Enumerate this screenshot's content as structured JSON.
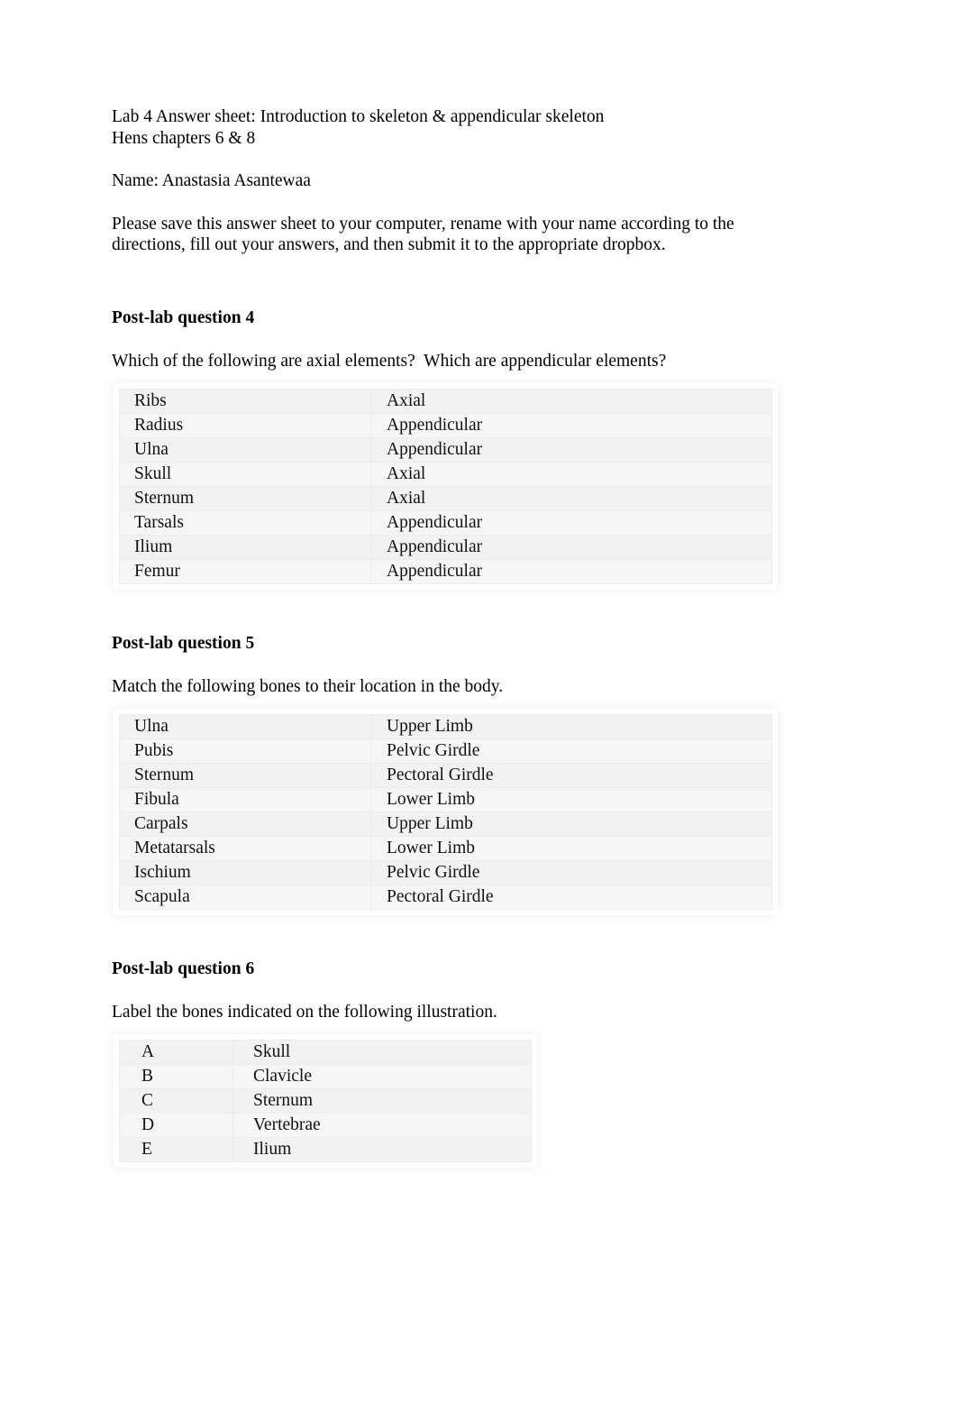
{
  "document": {
    "title_line_1": "Lab 4 Answer sheet: Introduction to skeleton & appendicular skeleton",
    "title_line_2": "Hens chapters 6 & 8",
    "name_line": "Name: Anastasia Asantewaa",
    "instructions": "Please save this answer sheet to your computer, rename with your name according to the directions, fill out your answers, and then submit it to the appropriate dropbox."
  },
  "sections": [
    {
      "heading": "Post-lab question 4",
      "question": "Which of the following are axial elements?  Which are appendicular elements?",
      "rows": [
        {
          "term": "Ribs",
          "answer": "Axial"
        },
        {
          "term": "Radius",
          "answer": "Appendicular"
        },
        {
          "term": "Ulna",
          "answer": "Appendicular"
        },
        {
          "term": "Skull",
          "answer": "Axial"
        },
        {
          "term": "Sternum",
          "answer": "Axial"
        },
        {
          "term": "Tarsals",
          "answer": "Appendicular"
        },
        {
          "term": "Ilium",
          "answer": "Appendicular"
        },
        {
          "term": "Femur",
          "answer": "Appendicular"
        }
      ]
    },
    {
      "heading": "Post-lab question 5",
      "question": "Match the following bones to their location in the body.",
      "rows": [
        {
          "term": "Ulna",
          "answer": "Upper Limb"
        },
        {
          "term": "Pubis",
          "answer": "Pelvic Girdle"
        },
        {
          "term": "Sternum",
          "answer": "Pectoral Girdle"
        },
        {
          "term": "Fibula",
          "answer": "Lower Limb"
        },
        {
          "term": "Carpals",
          "answer": "Upper Limb"
        },
        {
          "term": "Metatarsals",
          "answer": "Lower Limb"
        },
        {
          "term": "Ischium",
          "answer": "Pelvic Girdle"
        },
        {
          "term": "Scapula",
          "answer": "Pectoral Girdle"
        }
      ]
    },
    {
      "heading": "Post-lab question 6",
      "question": "Label the bones indicated on the following illustration.",
      "rows": [
        {
          "term": "A",
          "answer": "Skull"
        },
        {
          "term": "B",
          "answer": "Clavicle"
        },
        {
          "term": "C",
          "answer": "Sternum"
        },
        {
          "term": "D",
          "answer": "Vertebrae"
        },
        {
          "term": "E",
          "answer": "Ilium"
        }
      ]
    }
  ],
  "colors": {
    "page_background": "#ffffff",
    "text": "#000000",
    "table_cell_background": "#f2f2f2",
    "table_cell_background_alt": "#f6f6f6",
    "table_border": "#ececec"
  }
}
